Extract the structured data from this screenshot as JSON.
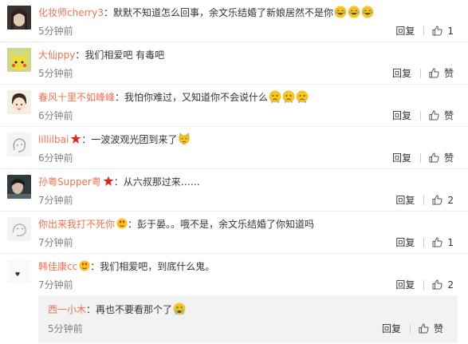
{
  "comments": [
    {
      "name": "化妆师cherry3",
      "sep": "：",
      "text": "默默不知道怎么回事，余文乐结婚了新娘居然不是你",
      "emoji": [
        "laugh-cry-emoji",
        "laugh-cry-emoji",
        "laugh-cry-emoji"
      ],
      "time": "5分钟前",
      "reply": "回复",
      "like": "1"
    },
    {
      "name": "大仙ppy",
      "sep": "：",
      "text": "我们相爱吧 有毒吧",
      "time": "5分钟前",
      "reply": "回复",
      "like": "赞"
    },
    {
      "name": "春风十里不如峰峰",
      "sep": "：",
      "text": "我怕你难过，又知道你不会说什么",
      "emoji": [
        "sad-emoji",
        "sad-emoji",
        "sad-emoji"
      ],
      "time": "6分钟前",
      "reply": "回复",
      "like": "赞"
    },
    {
      "name": "lillilbai",
      "badge": "star-badge",
      "sep": "：",
      "text": "一波波观光团到来了",
      "emoji": [
        "cat-emoji"
      ],
      "time": "6分钟前",
      "reply": "回复",
      "like": "赞"
    },
    {
      "name": "孙粤Supper粤",
      "badge": "star-badge",
      "sep": "：",
      "text": "从六叔那过来……",
      "time": "7分钟前",
      "reply": "回复",
      "like": "2"
    },
    {
      "name": "你出来我打不死你",
      "badge": "heart-badge",
      "sep": "：",
      "text": "彭于晏。。哦不是，余文乐结婚了你知道吗",
      "time": "7分钟前",
      "reply": "回复",
      "like": "1"
    },
    {
      "name": "韩佳康cc",
      "badge": "heart-badge",
      "sep": "：",
      "text": "我们相爱吧，到底什么鬼。",
      "time": "7分钟前",
      "reply": "回复",
      "like": "2"
    }
  ],
  "subcomment": {
    "name": "西一小木",
    "sep": "：",
    "text": "再也不要看那个了",
    "emoji": [
      "crying-emoji"
    ],
    "time": "5分钟前",
    "reply": "回复",
    "like": "赞"
  },
  "colors": {
    "name": "#eb7350",
    "star": "#e2231a",
    "emoji": "#f7c325",
    "time": "#808080",
    "sub_bg": "#f2f2f2"
  }
}
